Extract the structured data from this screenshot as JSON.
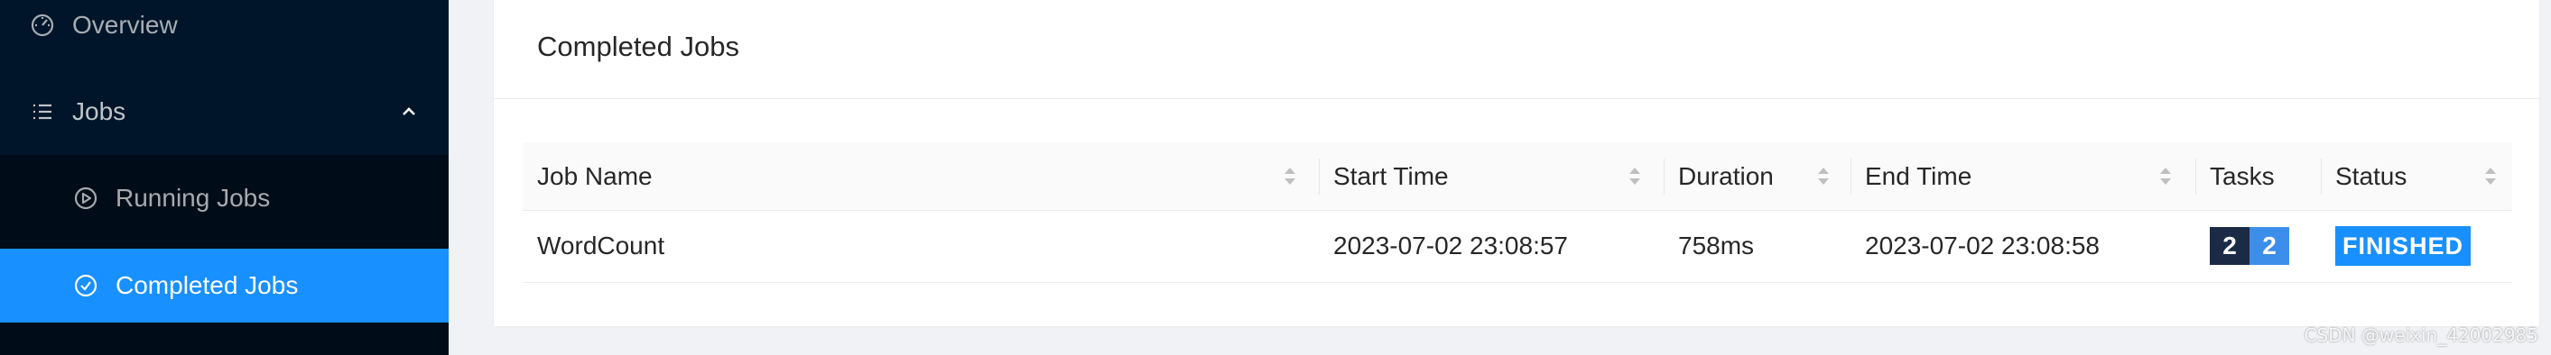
{
  "sidebar": {
    "items": [
      {
        "label": "Overview",
        "icon": "dashboard-icon"
      },
      {
        "label": "Jobs",
        "icon": "list-icon",
        "expanded": true,
        "children": [
          {
            "label": "Running Jobs",
            "icon": "play-circle-icon"
          },
          {
            "label": "Completed Jobs",
            "icon": "check-circle-icon",
            "selected": true
          }
        ]
      }
    ]
  },
  "main": {
    "card_title": "Completed Jobs",
    "table": {
      "columns": [
        "Job Name",
        "Start Time",
        "Duration",
        "End Time",
        "Tasks",
        "Status"
      ],
      "rows": [
        {
          "job_name": "WordCount",
          "start_time": "2023-07-02 23:08:57",
          "duration": "758ms",
          "end_time": "2023-07-02 23:08:58",
          "tasks": [
            "2",
            "2"
          ],
          "status": "FINISHED"
        }
      ]
    }
  },
  "colors": {
    "sidebar_bg": "#001529",
    "submenu_bg": "#000c17",
    "selected_bg": "#1890ff",
    "task_badge_dark": "#1b2a45",
    "task_badge_blue": "#3d8eea",
    "status_finished": "#1890ff"
  },
  "watermark": "CSDN @weixin_42002985"
}
